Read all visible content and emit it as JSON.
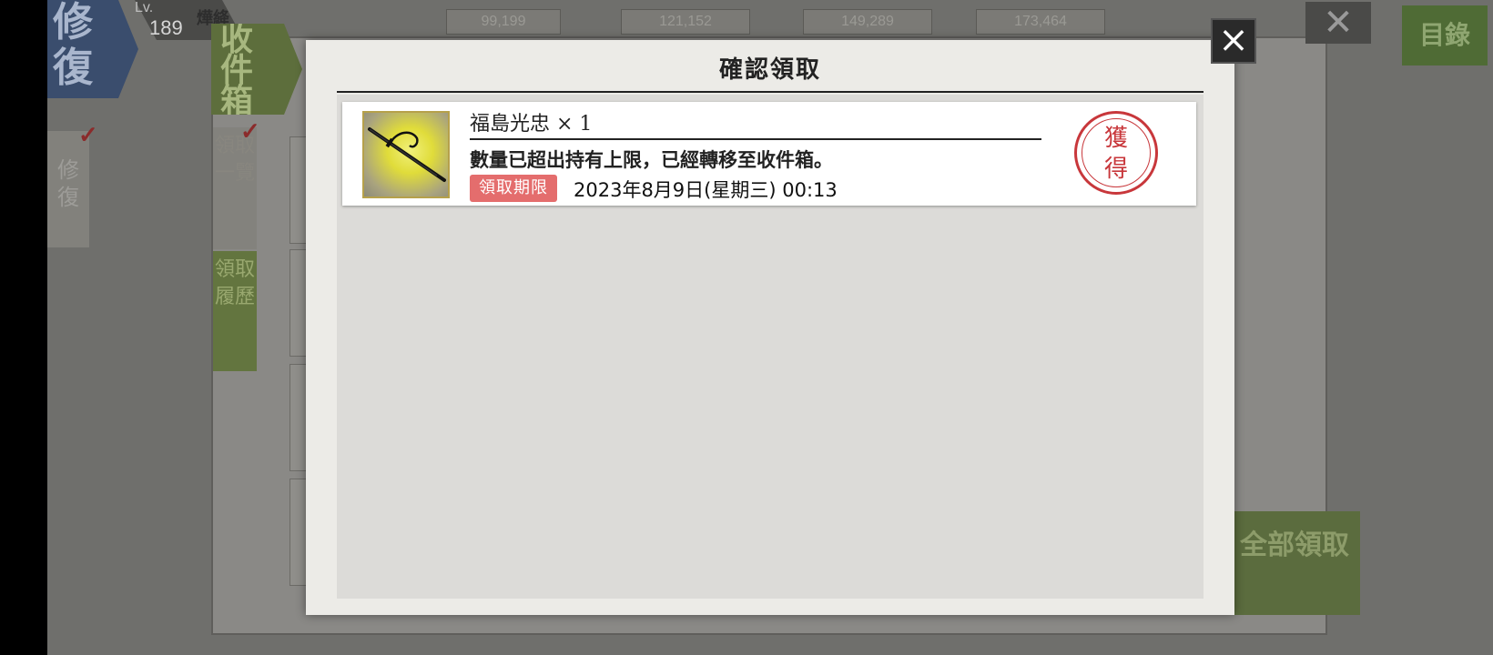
{
  "background": {
    "repair_tag": "修復",
    "level_label": "Lv.",
    "level_value": "189",
    "player_name": "燁絳",
    "box_tag": "收件箱",
    "left_tab": "修復",
    "side_tabs": [
      "領取一覽",
      "領取履歷"
    ],
    "catalog_button": "目錄",
    "bulk_claim_button": "全部領取",
    "resources": [
      "99,199",
      "121,152",
      "149,289",
      "173,464"
    ]
  },
  "modal": {
    "title": "確認領取",
    "close_icon": "×",
    "item": {
      "icon": "katana-icon",
      "name": "福島光忠 × 1",
      "message": "數量已超出持有上限，已經轉移至收件箱。",
      "deadline_label": "領取期限",
      "deadline_value": "2023年8月9日(星期三) 00:13",
      "stamp_text": "獲得"
    }
  },
  "colors": {
    "stamp_red": "#c8373b",
    "badge_red": "#e46d6d",
    "modal_bg": "#ecebe7"
  }
}
